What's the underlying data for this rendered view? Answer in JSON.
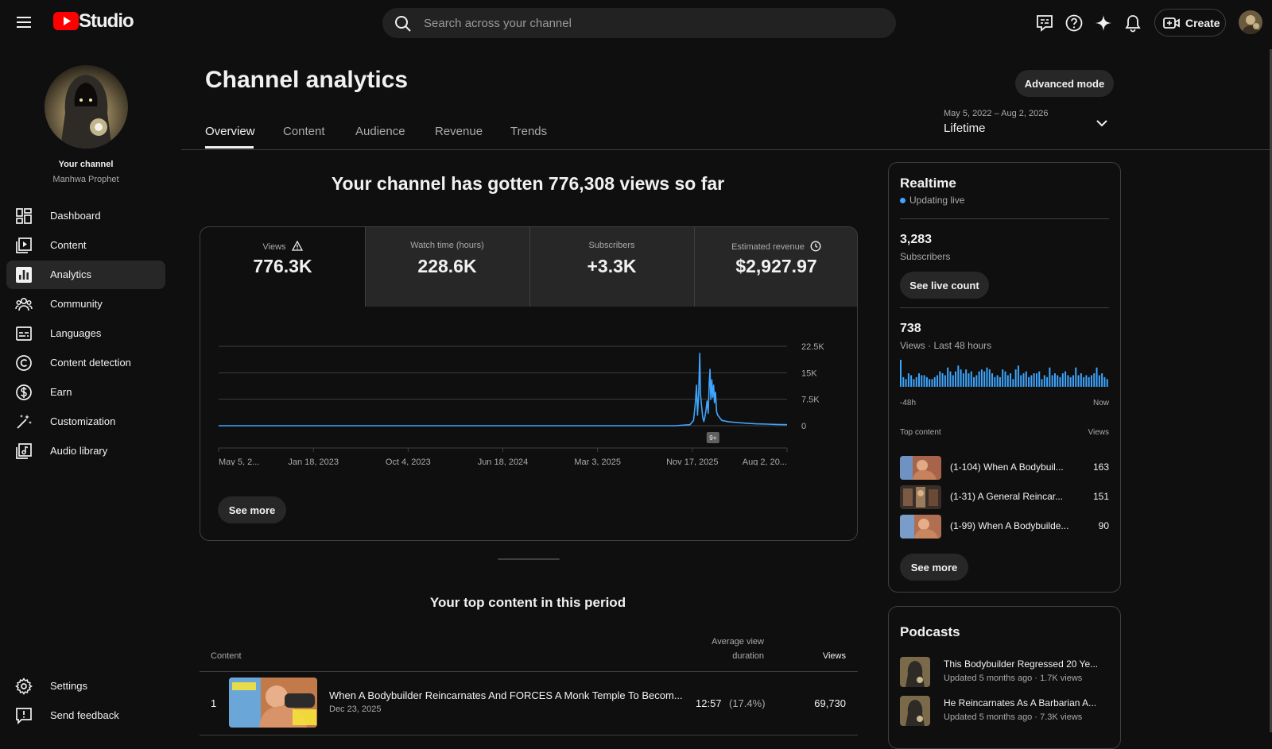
{
  "app": {
    "logo_text": "Studio",
    "search_placeholder": "Search across your channel",
    "create_label": "Create"
  },
  "sidebar": {
    "channel_title": "Your channel",
    "channel_name": "Manhwa Prophet",
    "items": [
      {
        "label": "Dashboard",
        "icon": "dashboard-icon"
      },
      {
        "label": "Content",
        "icon": "content-icon"
      },
      {
        "label": "Analytics",
        "icon": "analytics-icon",
        "active": true
      },
      {
        "label": "Community",
        "icon": "community-icon"
      },
      {
        "label": "Languages",
        "icon": "languages-icon"
      },
      {
        "label": "Content detection",
        "icon": "copyright-icon"
      },
      {
        "label": "Earn",
        "icon": "dollar-icon"
      },
      {
        "label": "Customization",
        "icon": "magic-wand-icon"
      },
      {
        "label": "Audio library",
        "icon": "audio-library-icon"
      }
    ],
    "bottom_items": [
      {
        "label": "Settings",
        "icon": "gear-icon"
      },
      {
        "label": "Send feedback",
        "icon": "feedback-icon"
      }
    ]
  },
  "main": {
    "title": "Channel analytics",
    "advanced_mode_label": "Advanced mode",
    "tabs": [
      "Overview",
      "Content",
      "Audience",
      "Revenue",
      "Trends"
    ],
    "active_tab": "Overview",
    "date_range": "May 5, 2022 – Aug 2, 2026",
    "period_label": "Lifetime",
    "headline": "Your channel has gotten 776,308 views so far",
    "metrics": [
      {
        "label": "Views",
        "value": "776.3K",
        "icon": "warning-icon"
      },
      {
        "label": "Watch time (hours)",
        "value": "228.6K"
      },
      {
        "label": "Subscribers",
        "value": "+3.3K"
      },
      {
        "label": "Estimated revenue",
        "value": "$2,927.97",
        "icon": "clock-icon"
      }
    ],
    "chart_see_more": "See more",
    "top_content_title": "Your top content in this period",
    "table_headers": {
      "content": "Content",
      "avg_duration_1": "Average view",
      "avg_duration_2": "duration",
      "views": "Views"
    },
    "top_rows": [
      {
        "rank": "1",
        "title": "When A Bodybuilder Reincarnates And FORCES A Monk Temple To Becom...",
        "date": "Dec 23, 2025",
        "duration": "12:57",
        "percent": "(17.4%)",
        "views": "69,730"
      }
    ]
  },
  "chart_data": {
    "type": "line",
    "x_tick_labels": [
      "May 5, 2...",
      "Jan 18, 2023",
      "Oct 4, 2023",
      "Jun 18, 2024",
      "Mar 3, 2025",
      "Nov 17, 2025",
      "Aug 2, 20..."
    ],
    "y_tick_labels": [
      "0",
      "7.5K",
      "15K",
      "22.5K"
    ],
    "ylim": [
      0,
      22500
    ],
    "grid": true,
    "annotation_badge": "9+",
    "series": [
      {
        "color": "#3ea6ff",
        "points": [
          [
            "2022-05-05",
            0
          ],
          [
            "2025-10-01",
            0
          ],
          [
            "2025-11-10",
            300
          ],
          [
            "2025-11-20",
            1500
          ],
          [
            "2025-11-25",
            6500
          ],
          [
            "2025-11-28",
            11500
          ],
          [
            "2025-12-01",
            3000
          ],
          [
            "2025-12-04",
            9000
          ],
          [
            "2025-12-07",
            20500
          ],
          [
            "2025-12-09",
            9000
          ],
          [
            "2025-12-12",
            5500
          ],
          [
            "2025-12-15",
            2500
          ],
          [
            "2025-12-18",
            1200
          ],
          [
            "2025-12-21",
            2500
          ],
          [
            "2025-12-24",
            4500
          ],
          [
            "2025-12-27",
            7000
          ],
          [
            "2025-12-30",
            3500
          ],
          [
            "2026-01-02",
            12500
          ],
          [
            "2026-01-04",
            16000
          ],
          [
            "2026-01-06",
            7500
          ],
          [
            "2026-01-09",
            13000
          ],
          [
            "2026-01-11",
            8000
          ],
          [
            "2026-01-14",
            11500
          ],
          [
            "2026-01-16",
            6500
          ],
          [
            "2026-01-19",
            9500
          ],
          [
            "2026-01-22",
            4000
          ],
          [
            "2026-01-25",
            3000
          ],
          [
            "2026-02-05",
            1500
          ],
          [
            "2026-02-25",
            1100
          ],
          [
            "2026-03-20",
            900
          ],
          [
            "2026-04-15",
            700
          ],
          [
            "2026-05-10",
            550
          ],
          [
            "2026-06-10",
            450
          ],
          [
            "2026-07-05",
            350
          ],
          [
            "2026-08-02",
            300
          ]
        ]
      }
    ]
  },
  "realtime": {
    "title": "Realtime",
    "status": "Updating live",
    "subscribers_value": "3,283",
    "subscribers_label": "Subscribers",
    "see_live_count": "See live count",
    "views_value": "738",
    "views_label": "Views · Last 48 hours",
    "axis_start": "-48h",
    "axis_end": "Now",
    "bar_values": [
      14,
      5,
      4,
      7,
      6,
      4,
      5,
      7,
      6,
      6,
      5,
      4,
      4,
      5,
      6,
      8,
      7,
      6,
      10,
      8,
      6,
      8,
      11,
      9,
      7,
      9,
      7,
      8,
      5,
      6,
      8,
      9,
      8,
      10,
      9,
      7,
      5,
      6,
      5,
      9,
      8,
      6,
      7,
      4,
      9,
      11,
      6,
      7,
      8,
      5,
      6,
      7,
      7,
      8,
      4,
      6,
      5,
      10,
      6,
      7,
      6,
      5,
      7,
      8,
      6,
      5,
      6,
      10,
      6,
      7,
      5,
      6,
      5,
      6,
      7,
      10,
      6,
      7,
      5,
      4
    ],
    "top_content_label": "Top content",
    "top_views_label": "Views",
    "top_items": [
      {
        "title": "(1-104) When A Bodybuil...",
        "views": "163"
      },
      {
        "title": "(1-31) A General Reincar...",
        "views": "151"
      },
      {
        "title": "(1-99) When A Bodybuilde...",
        "views": "90"
      }
    ],
    "see_more": "See more"
  },
  "podcasts": {
    "title": "Podcasts",
    "items": [
      {
        "title": "This Bodybuilder Regressed 20 Ye...",
        "sub": "Updated 5 months ago · 1.7K views"
      },
      {
        "title": "He Reincarnates As A Barbarian A...",
        "sub": "Updated 5 months ago · 7.3K views"
      }
    ]
  },
  "colors": {
    "accent": "#3ea6ff",
    "brand_red": "#ff0000",
    "bg": "#0f0f0f",
    "card": "#272727"
  }
}
